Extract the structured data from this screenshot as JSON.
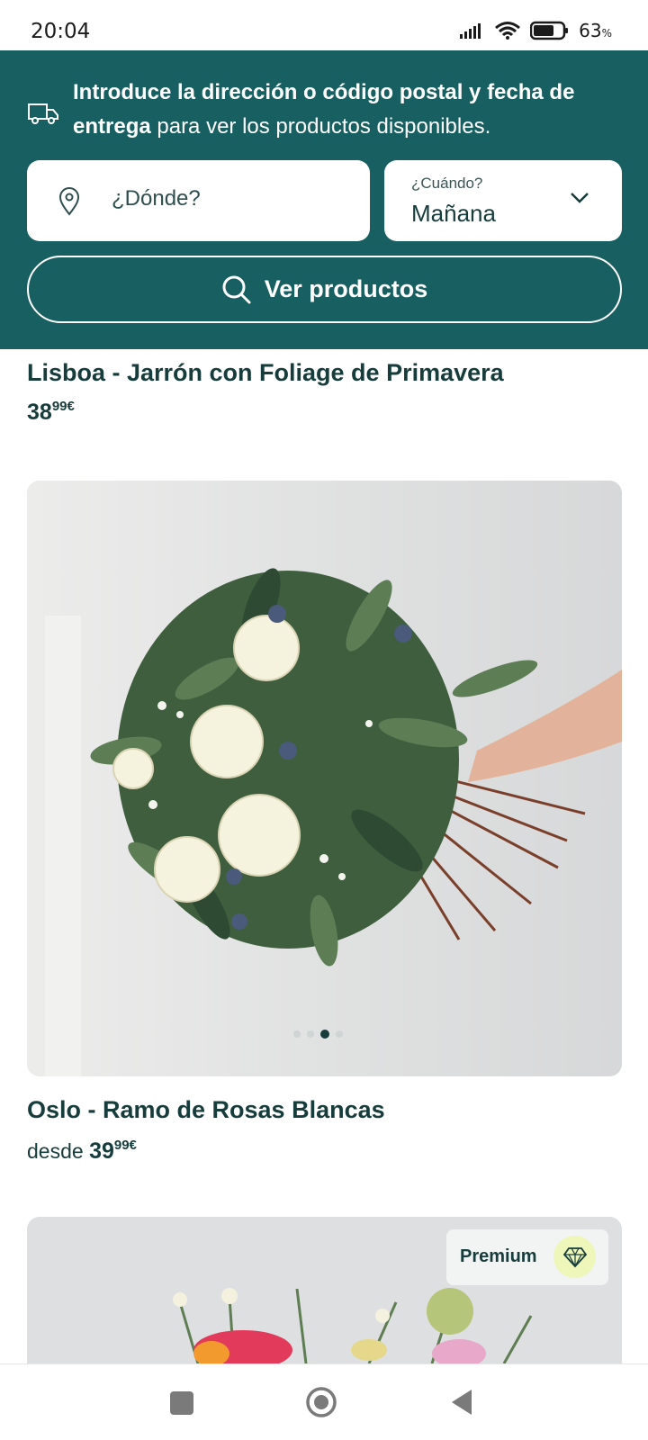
{
  "status_bar": {
    "time": "20:04",
    "battery_percent": "63",
    "battery_symbol": "%"
  },
  "header": {
    "intro_bold_1": "Introduce la dirección o código postal y fecha de entrega",
    "intro_rest": " para ver los productos disponibles.",
    "where_placeholder": "¿Dónde?",
    "when_label": "¿Cuándo?",
    "when_value": "Mañana",
    "view_button": "Ver productos"
  },
  "products": [
    {
      "title": "Lisboa - Jarrón con Foliage de Primavera",
      "price_prefix": "",
      "price_int": "38",
      "price_dec": "99€"
    },
    {
      "title": "Oslo - Ramo de Rosas Blancas",
      "price_prefix": "desde ",
      "price_int": "39",
      "price_dec": "99€",
      "carousel_dots": 4,
      "active_dot": 2
    },
    {
      "badge": "Premium"
    }
  ],
  "icons": {
    "delivery": "truck-icon",
    "location": "location-pin-icon",
    "chevron": "chevron-down-icon",
    "search": "search-icon",
    "premium": "diamond-icon"
  },
  "colors": {
    "primary": "#175f60",
    "text": "#173c3c",
    "premium_badge_icon_bg": "#eef7b9"
  }
}
